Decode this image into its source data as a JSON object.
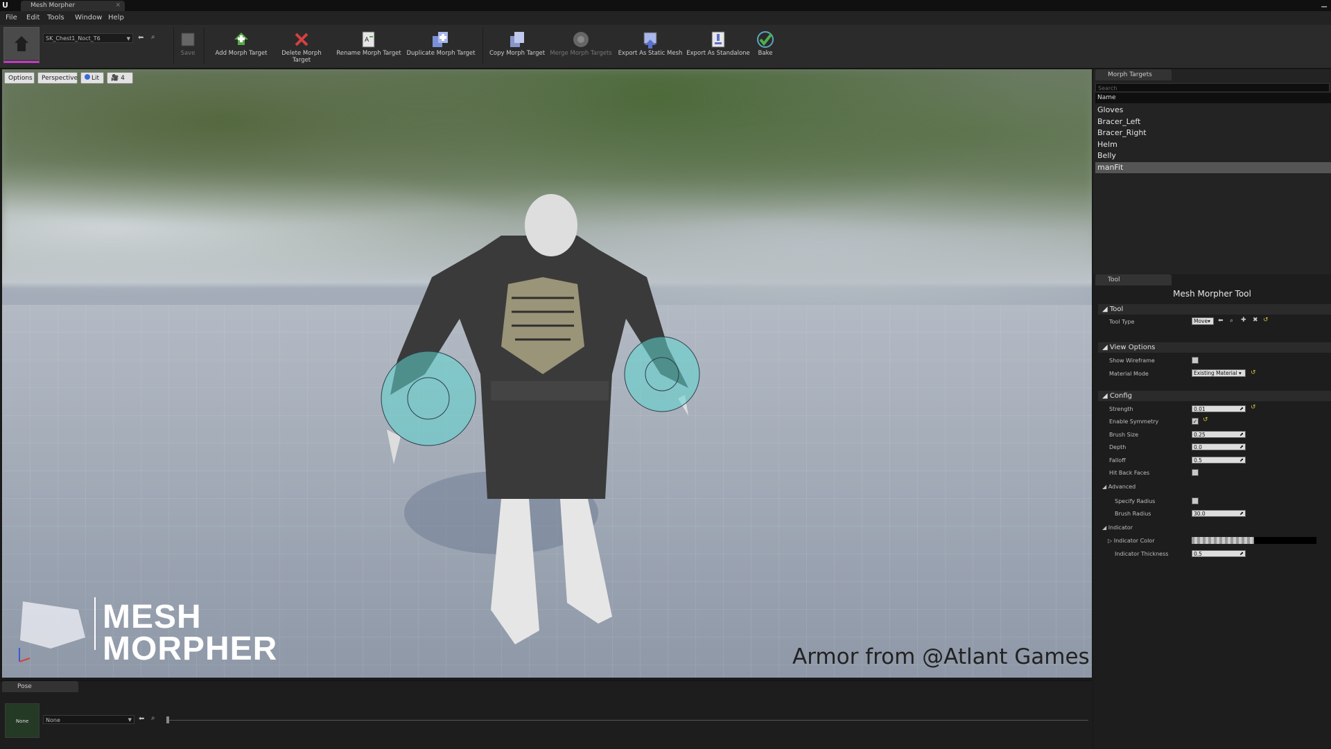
{
  "window": {
    "title": "Mesh Morpher"
  },
  "menu": [
    "File",
    "Edit",
    "Tools",
    "Window",
    "Help"
  ],
  "toolbar": {
    "asset_selector": "SK_Chest1_Noct_T6",
    "buttons": [
      {
        "label": "Save",
        "icon": "save-icon",
        "enabled": false
      },
      {
        "label": "Add Morph Target",
        "icon": "add-icon",
        "enabled": true
      },
      {
        "label": "Delete Morph Target",
        "icon": "delete-icon",
        "enabled": true
      },
      {
        "label": "Rename Morph Target",
        "icon": "rename-icon",
        "enabled": true
      },
      {
        "label": "Duplicate Morph Target",
        "icon": "duplicate-icon",
        "enabled": true
      },
      {
        "label": "Copy Morph Target",
        "icon": "copy-icon",
        "enabled": true
      },
      {
        "label": "Merge Morph Targets",
        "icon": "merge-icon",
        "enabled": false
      },
      {
        "label": "Export As Static Mesh",
        "icon": "export-static-mesh-icon",
        "enabled": true
      },
      {
        "label": "Export As Standalone",
        "icon": "export-standalone-icon",
        "enabled": true
      },
      {
        "label": "Bake",
        "icon": "bake-checkmark-icon",
        "enabled": true
      }
    ]
  },
  "viewport": {
    "options_label": "Options",
    "view_mode_label": "Perspective",
    "lighting_label": "Lit",
    "camera_speed": "4",
    "watermark": "Armor from @Atlant Games",
    "logo_line1": "MESH",
    "logo_line2": "MORPHER"
  },
  "morph_targets": {
    "tab_label": "Morph Targets",
    "search_placeholder": "Search",
    "column_header": "Name",
    "items": [
      "Gloves",
      "Bracer_Left",
      "Bracer_Right",
      "Helm",
      "Belly",
      "manFit"
    ],
    "selected": "manFit"
  },
  "tool_panel": {
    "tab_label": "Tool",
    "title": "Mesh Morpher Tool",
    "categories": {
      "tool": "Tool",
      "view_options": "View Options",
      "config": "Config",
      "advanced": "Advanced",
      "indicator": "Indicator"
    },
    "props": {
      "tool_type_label": "Tool Type",
      "tool_type_value": "Move",
      "show_wireframe_label": "Show Wireframe",
      "show_wireframe": false,
      "material_mode_label": "Material Mode",
      "material_mode_value": "Existing Material",
      "strength_label": "Strength",
      "strength_value": "0.01",
      "enable_symmetry_label": "Enable Symmetry",
      "enable_symmetry": true,
      "brush_size_label": "Brush Size",
      "brush_size_value": "0.25",
      "depth_label": "Depth",
      "depth_value": "0.0",
      "falloff_label": "Falloff",
      "falloff_value": "0.5",
      "hit_back_faces_label": "Hit Back Faces",
      "hit_back_faces": false,
      "specify_radius_label": "Specify Radius",
      "specify_radius": false,
      "brush_radius_label": "Brush Radius",
      "brush_radius_value": "30.0",
      "indicator_color_label": "Indicator Color",
      "indicator_thickness_label": "Indicator Thickness",
      "indicator_thickness_value": "0.5"
    }
  },
  "pose": {
    "tab_label": "Pose",
    "thumbnail_label": "None",
    "selector_value": "None"
  },
  "colors": {
    "brush_indicator": "#5fd6d0",
    "selection_accent": "#c13ac1",
    "reset_arrow": "#d7c23c",
    "bake_check": "#4caf50",
    "delete_x": "#d64040"
  }
}
